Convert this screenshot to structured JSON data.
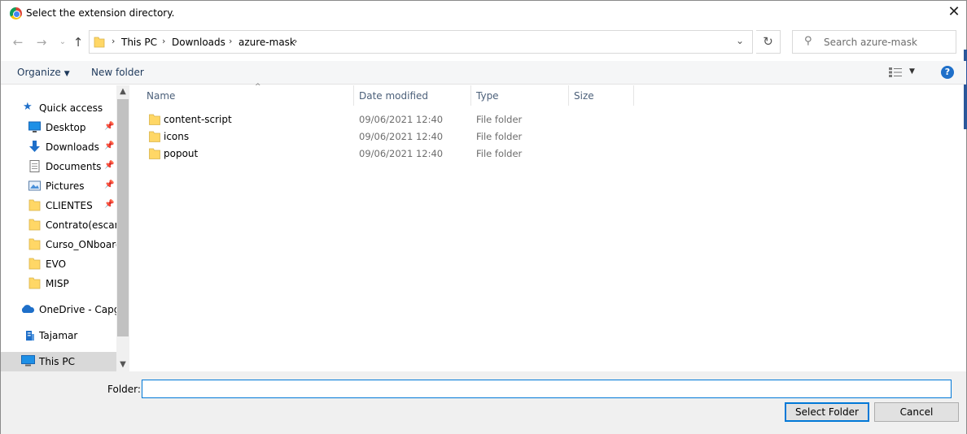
{
  "window": {
    "title": "Select the extension directory."
  },
  "address": {
    "breadcrumbs": [
      "This PC",
      "Downloads",
      "azure-mask"
    ],
    "search_placeholder": "Search azure-mask"
  },
  "commands": {
    "organize": "Organize",
    "new_folder": "New folder",
    "help": "?"
  },
  "nav": {
    "items": [
      {
        "label": "Quick access",
        "icon": "star-icon",
        "pinned": false
      },
      {
        "label": "Desktop",
        "icon": "desktop-icon",
        "pinned": true
      },
      {
        "label": "Downloads",
        "icon": "download-arrow-icon",
        "pinned": true
      },
      {
        "label": "Documents",
        "icon": "document-icon",
        "pinned": true
      },
      {
        "label": "Pictures",
        "icon": "pictures-icon",
        "pinned": true
      },
      {
        "label": "CLIENTES",
        "icon": "folder-icon",
        "pinned": true
      },
      {
        "label": "Contrato(escane",
        "icon": "folder-icon",
        "pinned": false
      },
      {
        "label": "Curso_ONboard",
        "icon": "folder-icon",
        "pinned": false
      },
      {
        "label": "EVO",
        "icon": "folder-icon",
        "pinned": false
      },
      {
        "label": "MISP",
        "icon": "folder-icon",
        "pinned": false
      },
      {
        "label": "OneDrive - Capge",
        "icon": "cloud-icon",
        "pinned": false
      },
      {
        "label": "Tajamar",
        "icon": "building-icon",
        "pinned": false
      },
      {
        "label": "This PC",
        "icon": "computer-icon",
        "pinned": false,
        "selected": true
      }
    ]
  },
  "columns": {
    "name": "Name",
    "date": "Date modified",
    "type": "Type",
    "size": "Size"
  },
  "files": [
    {
      "name": "content-script",
      "date": "09/06/2021 12:40",
      "type": "File folder"
    },
    {
      "name": "icons",
      "date": "09/06/2021 12:40",
      "type": "File folder"
    },
    {
      "name": "popout",
      "date": "09/06/2021 12:40",
      "type": "File folder"
    }
  ],
  "bottom": {
    "folder_label": "Folder:",
    "folder_value": "",
    "select_button": "Select Folder",
    "cancel_button": "Cancel"
  },
  "colors": {
    "accent": "#0078d7",
    "folder": "#ffd766",
    "selection": "#d9d9d9"
  }
}
